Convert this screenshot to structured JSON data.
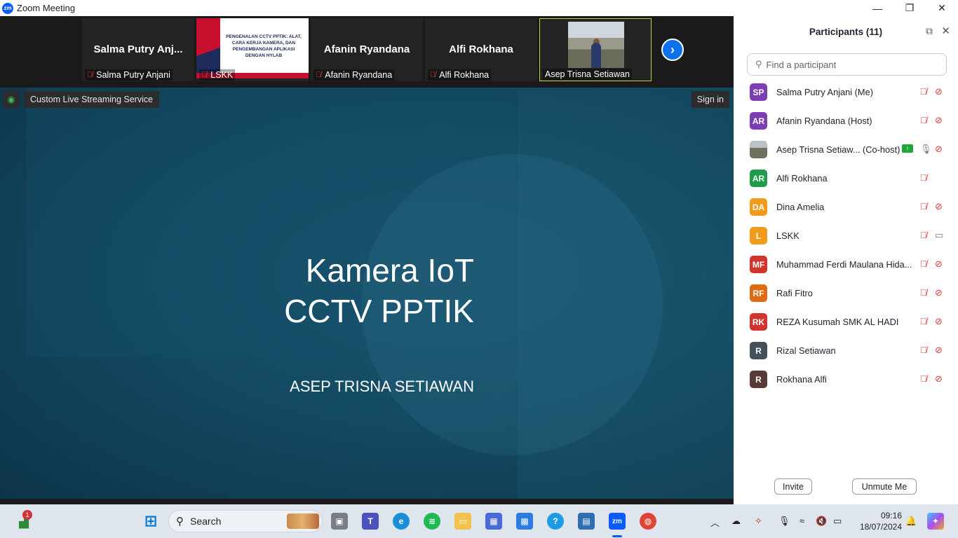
{
  "window": {
    "title": "Zoom Meeting",
    "app_icon": "zm",
    "controls": {
      "minimize": "—",
      "maximize": "❐",
      "close": "✕"
    }
  },
  "thumbnails": [
    {
      "center_name": "Salma  Putry  Anj...",
      "tag": "Salma Putry Anjani",
      "muted": true
    },
    {
      "center_name": "",
      "tag": "LSKK",
      "muted": true,
      "slide_text": "PENGENALAN CCTV PPTIK: ALAT, CARA KERJA KAMERA, DAN PENGEMBANGAN APLIKASI DENGAN HYLAB"
    },
    {
      "center_name": "Afanin Ryandana",
      "tag": "Afanin Ryandana",
      "muted": true
    },
    {
      "center_name": "Alfi Rokhana",
      "tag": "Alfi Rokhana",
      "muted": true
    },
    {
      "center_name": "",
      "tag": "Asep Trisna Setiawan",
      "muted": false
    }
  ],
  "next_button": "›",
  "share": {
    "live_label": "Custom Live Streaming Service",
    "signin_label": "Sign in",
    "slide_title_line1": "Kamera IoT",
    "slide_title_line2": "CCTV PPTIK",
    "slide_author": "ASEP TRISNA SETIAWAN"
  },
  "participants_panel": {
    "title": "Participants (11)",
    "search_placeholder": "Find a participant",
    "invite_label": "Invite",
    "unmute_label": "Unmute Me",
    "participants": [
      {
        "initials": "SP",
        "name": "Salma Putry Anjani (Me)",
        "color": "#7b3fb3",
        "mic": "off",
        "cam": "off"
      },
      {
        "initials": "AR",
        "name": "Afanin Ryandana (Host)",
        "color": "#7b3fb3",
        "mic": "off",
        "cam": "off"
      },
      {
        "initials": "",
        "name": "Asep Trisna Setiaw... (Co-host)",
        "color": "photo",
        "mic": "on",
        "cam": "off",
        "sharing": true
      },
      {
        "initials": "AR",
        "name": "Alfi Rokhana",
        "color": "#1e9e4a",
        "mic": "off",
        "cam": "none"
      },
      {
        "initials": "DA",
        "name": "Dina Amelia",
        "color": "#f29b1b",
        "mic": "off",
        "cam": "off"
      },
      {
        "initials": "L",
        "name": "LSKK",
        "color": "#f29b1b",
        "mic": "off",
        "cam": "on"
      },
      {
        "initials": "MF",
        "name": "Muhammad Ferdi Maulana Hida...",
        "color": "#d0342c",
        "mic": "off",
        "cam": "off"
      },
      {
        "initials": "RF",
        "name": "Rafi Fitro",
        "color": "#e06a12",
        "mic": "off",
        "cam": "off"
      },
      {
        "initials": "RK",
        "name": "REZA Kusumah SMK AL HADI",
        "color": "#d0342c",
        "mic": "off",
        "cam": "off"
      },
      {
        "initials": "R",
        "name": "Rizal Setiawan",
        "color": "#44505a",
        "mic": "off",
        "cam": "off"
      },
      {
        "initials": "R",
        "name": "Rokhana Alfi",
        "color": "#5a3a36",
        "mic": "off",
        "cam": "off"
      }
    ]
  },
  "taskbar": {
    "search_label": "Search",
    "notification_count": "1",
    "time": "09:16",
    "date": "18/07/2024"
  }
}
